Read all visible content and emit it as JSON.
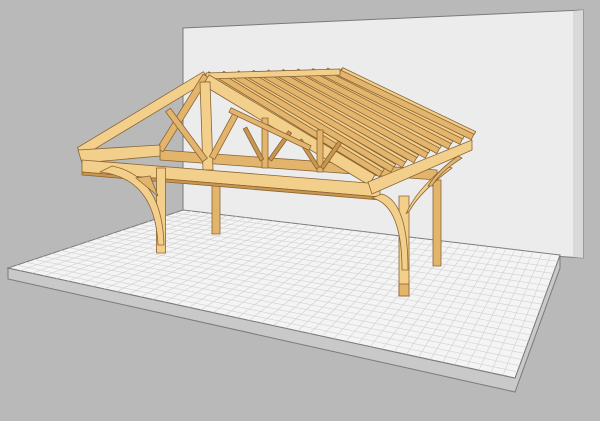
{
  "scene": {
    "subject": "timber-frame-carport-3d-model",
    "colors": {
      "background": "#b9b9b9",
      "back_wall": "#ececec",
      "back_wall_shadow": "#d6d6d6",
      "floor_top": "#f4f4f4",
      "floor_edge": "#c9c9c9",
      "floor_grid": "#d0d0d0",
      "wood_light": "#f3cf8c",
      "wood_mid": "#e2b46c",
      "wood_dark": "#c8964e",
      "wood_outline": "#8a6434"
    },
    "counts": {
      "rafters": 10,
      "trusses": 3
    }
  }
}
